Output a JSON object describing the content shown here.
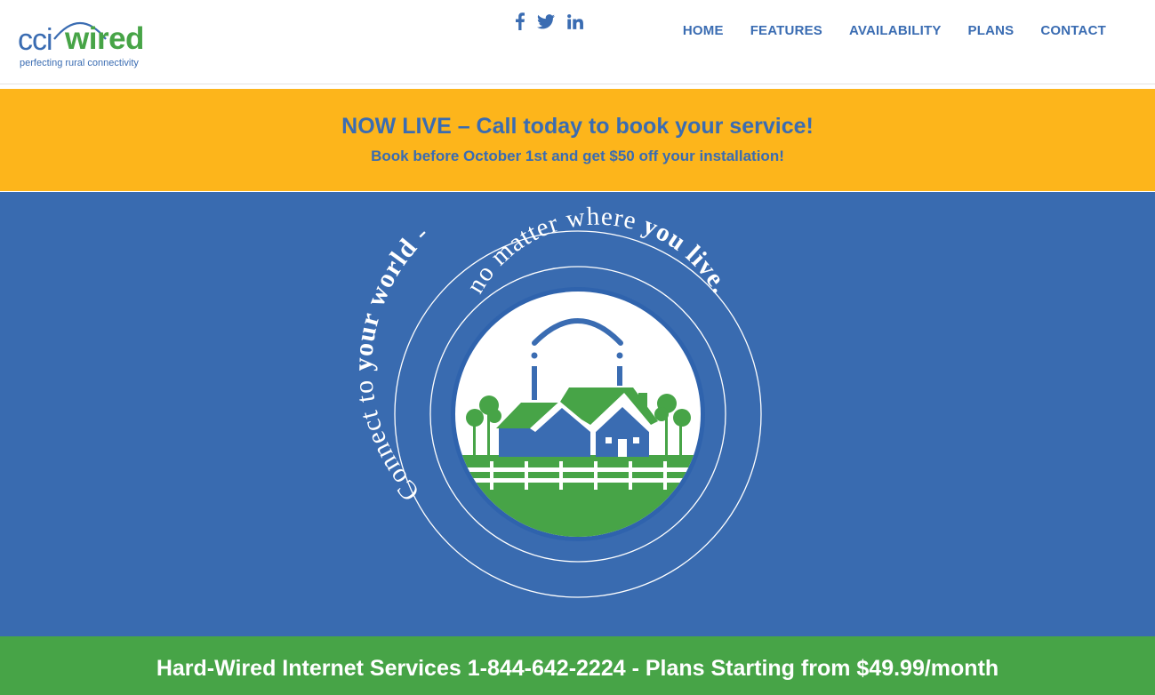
{
  "header": {
    "logo": {
      "brand_prefix": "cci",
      "brand_name": "wired",
      "tagline": "perfecting rural connectivity"
    },
    "social": [
      {
        "name": "facebook",
        "icon": "facebook-icon"
      },
      {
        "name": "twitter",
        "icon": "twitter-icon"
      },
      {
        "name": "linkedin",
        "icon": "linkedin-icon"
      }
    ],
    "nav": [
      "HOME",
      "FEATURES",
      "AVAILABILITY",
      "PLANS",
      "CONTACT"
    ]
  },
  "promo": {
    "title": "NOW LIVE – Call today to book your service!",
    "subtitle": "Book before October 1st and get $50 off your installation!"
  },
  "hero": {
    "tagline_line1_a": "Connect to ",
    "tagline_line1_b": "your world",
    "tagline_line1_c": " -",
    "tagline_line2_a": "no matter where ",
    "tagline_line2_b": "you live."
  },
  "footer_band": {
    "text": "Hard-Wired Internet Services 1-844-642-2224 - Plans Starting from $49.99/month"
  },
  "colors": {
    "primary_blue": "#3a6cb2",
    "brand_green": "#47a447",
    "promo_yellow": "#fdb51b",
    "hero_blue": "#396bb0"
  }
}
